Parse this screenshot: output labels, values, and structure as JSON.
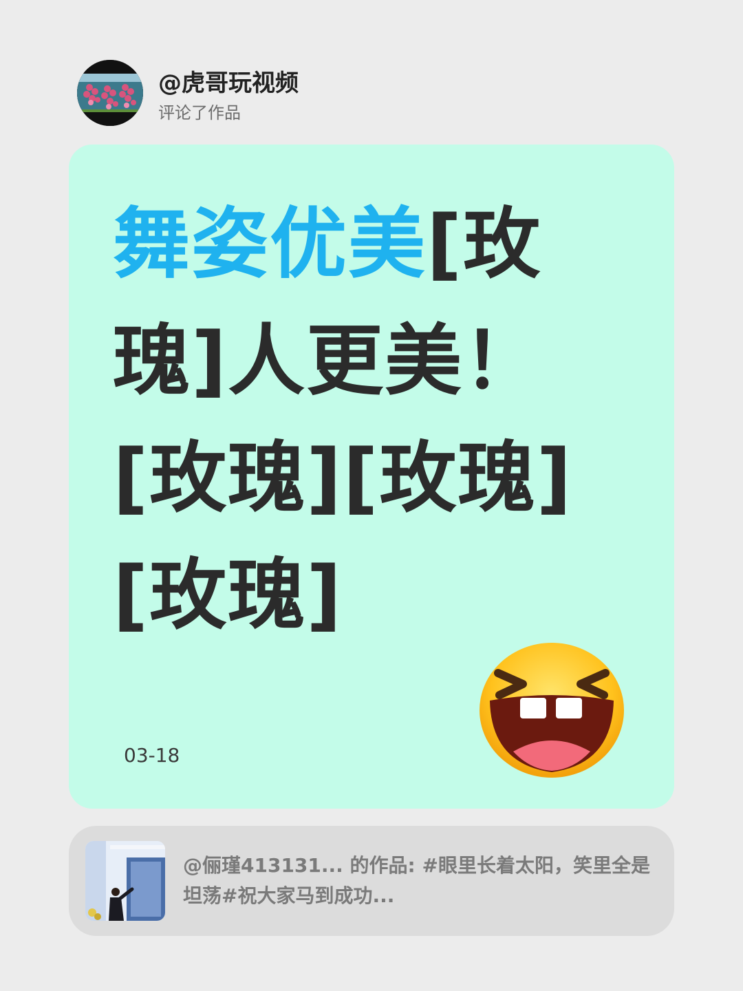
{
  "header": {
    "avatar_icon": "grape-photo-avatar",
    "username": "@虎哥玩视频",
    "action": "评论了作品"
  },
  "comment": {
    "highlight": "舞姿优美",
    "rest": "[玫瑰]人更美！[玫瑰][玫瑰][玫瑰]",
    "date": "03-18",
    "highlight_color": "#1fb2ef",
    "card_color": "#c3fce9"
  },
  "emoji": {
    "icon": "laughing-emoji"
  },
  "reference": {
    "thumbnail_icon": "video-thumbnail",
    "text": "@俪瑾413131... 的作品: #眼里长着太阳，笑里全是坦荡#祝大家马到成功..."
  }
}
